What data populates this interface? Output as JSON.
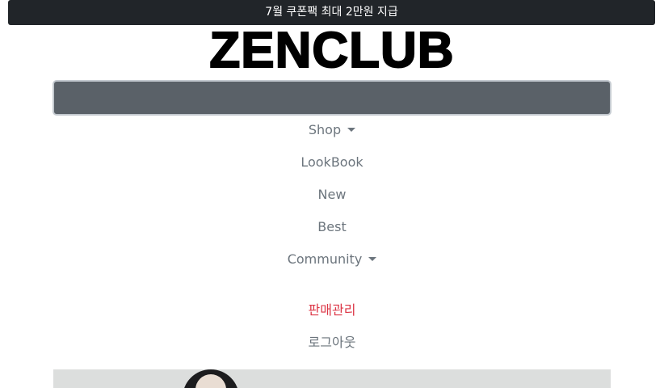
{
  "promo": {
    "text": "7월 쿠폰팩 최대 2만원 지급"
  },
  "brand": {
    "logo": "ZENCLUB"
  },
  "nav": {
    "items": [
      {
        "label": "Shop",
        "dropdown": true
      },
      {
        "label": "LookBook",
        "dropdown": false
      },
      {
        "label": "New",
        "dropdown": false
      },
      {
        "label": "Best",
        "dropdown": false
      },
      {
        "label": "Community",
        "dropdown": true
      }
    ],
    "admin_label": "판매관리",
    "logout_label": "로그아웃"
  },
  "colors": {
    "promo_bg": "#212529",
    "toggle_bg": "#5a6168",
    "nav_text": "#6c757d",
    "admin_text": "#dc3545"
  }
}
